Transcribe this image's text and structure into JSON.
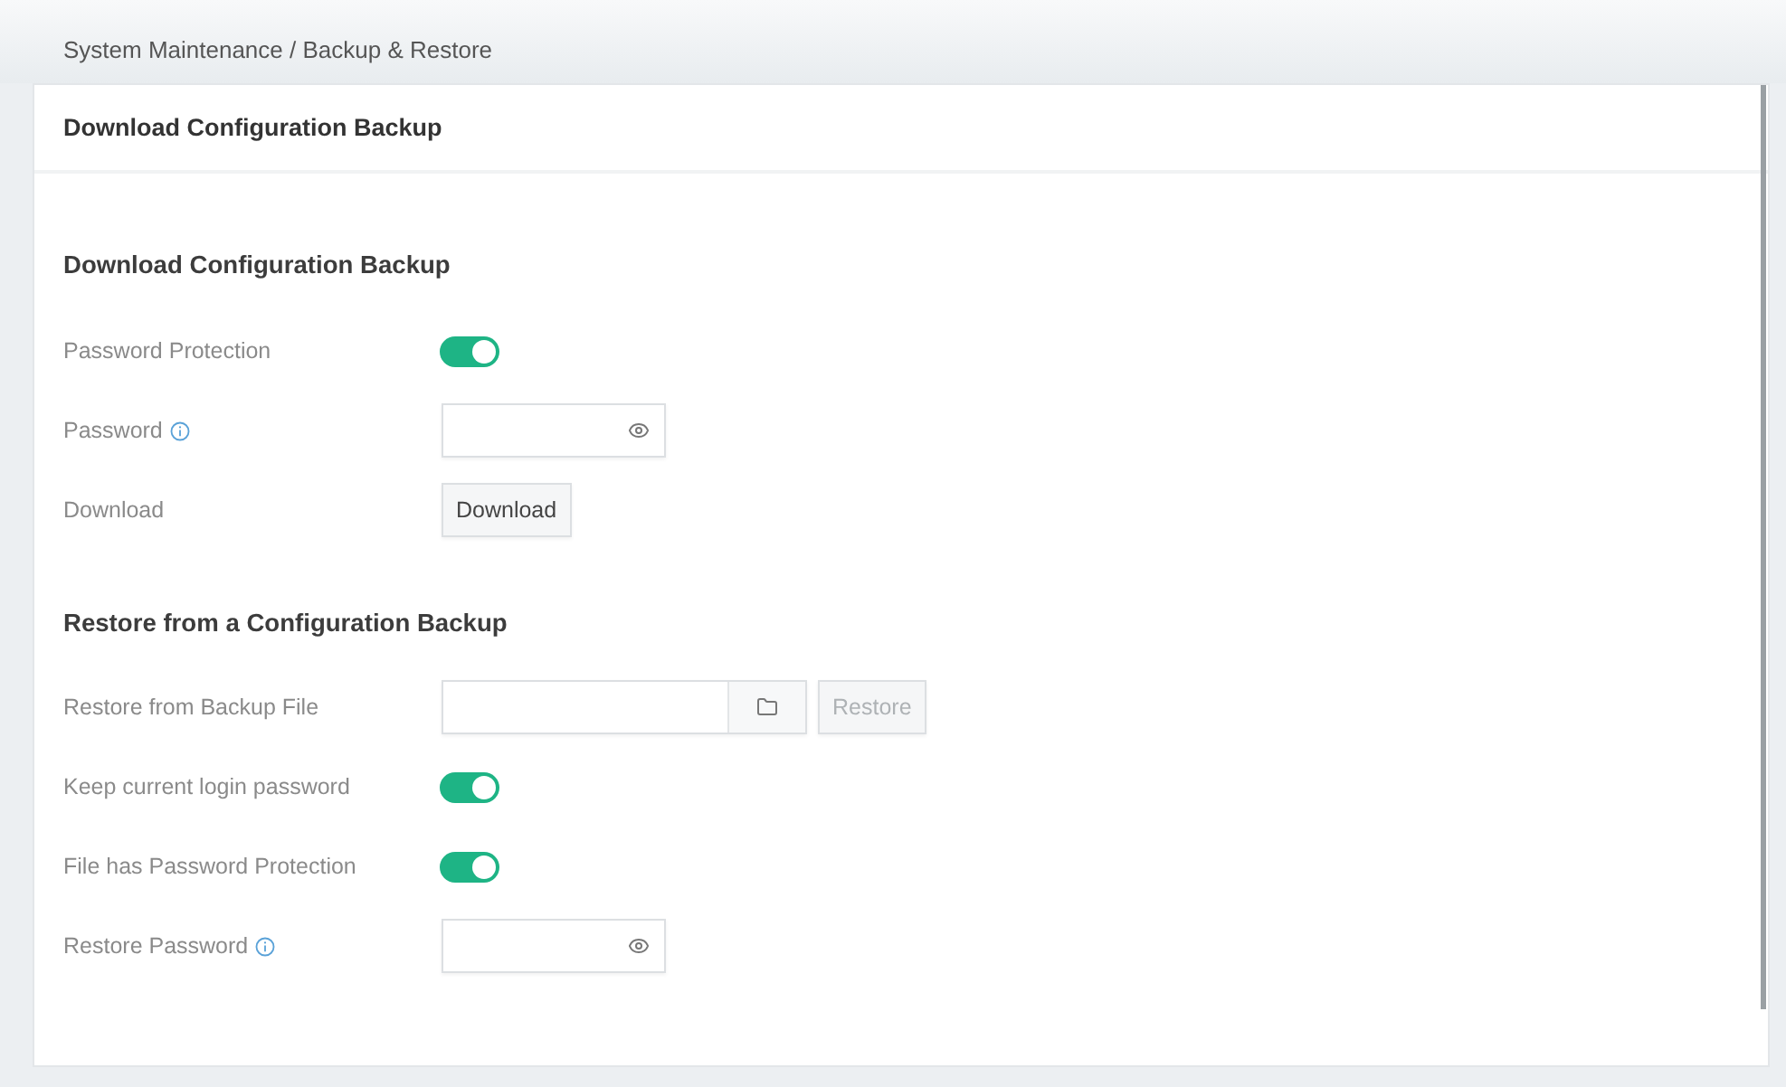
{
  "breadcrumb": "System Maintenance / Backup & Restore",
  "card": {
    "title": "Download Configuration Backup"
  },
  "sections": [
    {
      "title": "Download Configuration Backup",
      "rows": [
        {
          "kind": "toggle",
          "label": "Password Protection",
          "on": true
        },
        {
          "kind": "password",
          "label": "Password",
          "info": true
        },
        {
          "kind": "button",
          "label": "Download",
          "button": {
            "label": "Download",
            "disabled": false
          }
        }
      ]
    },
    {
      "title": "Restore from a Configuration Backup",
      "rows": [
        {
          "kind": "file",
          "label": "Restore from Backup File",
          "button": {
            "label": "Restore",
            "disabled": true
          }
        },
        {
          "kind": "toggle",
          "label": "Keep current login password",
          "on": true
        },
        {
          "kind": "toggle",
          "label": "File has Password Protection",
          "on": true
        },
        {
          "kind": "password",
          "label": "Restore Password",
          "info": true
        }
      ]
    }
  ]
}
